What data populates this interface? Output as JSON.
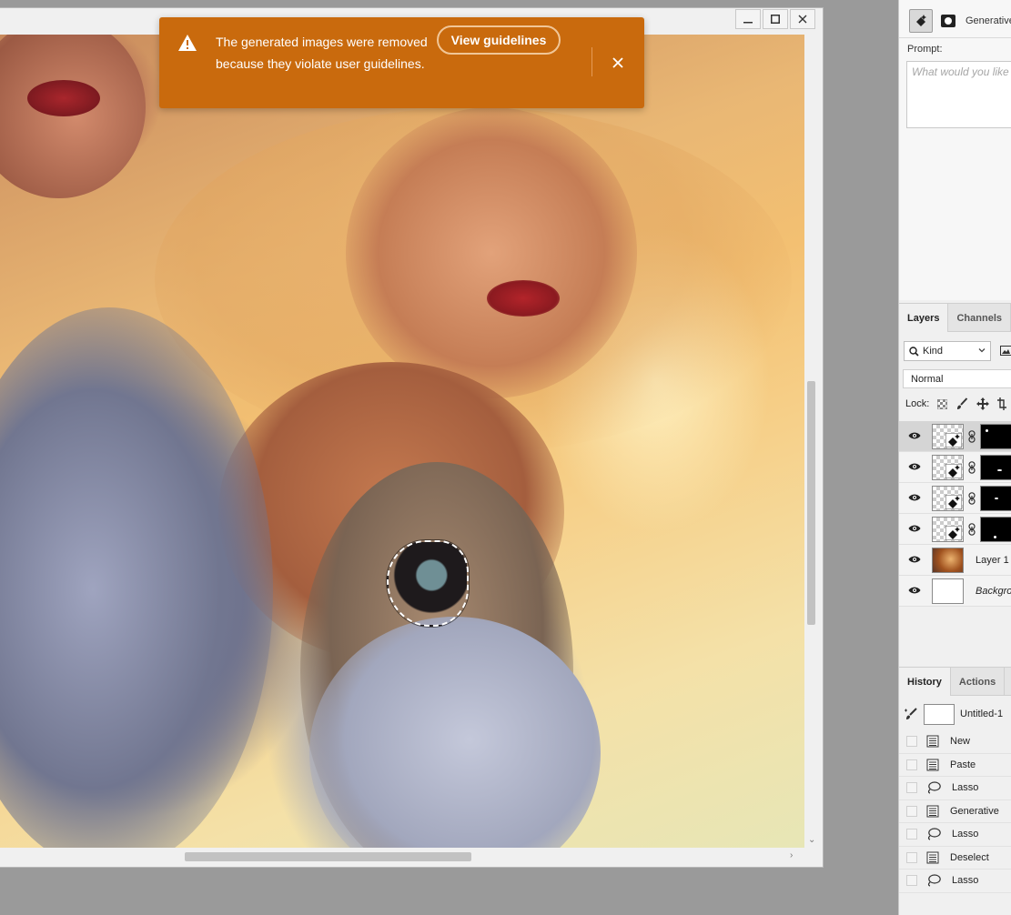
{
  "toast": {
    "message": "The generated images were removed because they violate user guidelines.",
    "guidelines_button": "View guidelines",
    "bg_color": "#c96a0d"
  },
  "window_controls": {
    "minimize_icon": "minimize-icon",
    "maximize_icon": "maximize-icon",
    "close_icon": "close-icon"
  },
  "generative_panel": {
    "title": "Generative",
    "prompt_label": "Prompt:",
    "prompt_placeholder": "What would you like"
  },
  "layers_panel": {
    "tabs": [
      {
        "label": "Layers",
        "active": true
      },
      {
        "label": "Channels",
        "active": false
      }
    ],
    "filter_kind": "Kind",
    "blend_mode": "Normal",
    "lock_label": "Lock:",
    "layers": [
      {
        "name": "",
        "type": "generative",
        "selected": true,
        "visible": true
      },
      {
        "name": "",
        "type": "generative",
        "selected": false,
        "visible": true
      },
      {
        "name": "",
        "type": "generative",
        "selected": false,
        "visible": true
      },
      {
        "name": "",
        "type": "generative",
        "selected": false,
        "visible": true
      },
      {
        "name": "Layer 1",
        "type": "image",
        "selected": false,
        "visible": true
      },
      {
        "name": "Backgro",
        "type": "background",
        "selected": false,
        "visible": true
      }
    ]
  },
  "history_panel": {
    "tabs": [
      {
        "label": "History",
        "active": true
      },
      {
        "label": "Actions",
        "active": false
      }
    ],
    "snapshot": "Untitled-1",
    "items": [
      {
        "label": "New",
        "icon": "document-icon"
      },
      {
        "label": "Paste",
        "icon": "document-icon"
      },
      {
        "label": "Lasso",
        "icon": "lasso-icon"
      },
      {
        "label": "Generative",
        "icon": "document-icon"
      },
      {
        "label": "Lasso",
        "icon": "lasso-icon"
      },
      {
        "label": "Deselect",
        "icon": "document-icon"
      },
      {
        "label": "Lasso",
        "icon": "lasso-icon"
      }
    ]
  }
}
